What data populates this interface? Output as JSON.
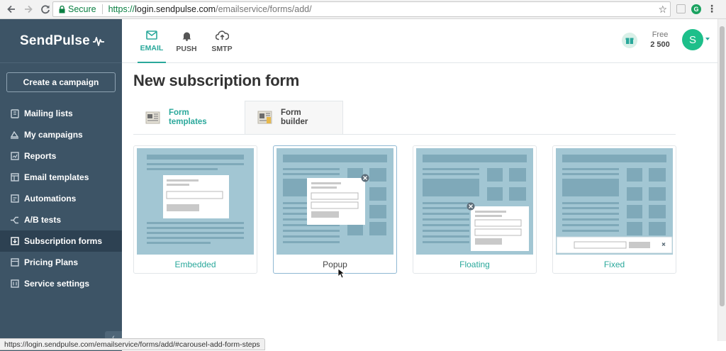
{
  "browser": {
    "secure_label": "Secure",
    "url_scheme": "https://",
    "url_host": "login.sendpulse.com",
    "url_path": "/emailservice/forms/add/",
    "status_url": "https://login.sendpulse.com/emailservice/forms/add/#carousel-add-form-steps"
  },
  "sidebar": {
    "logo": "SendPulse",
    "create_button": "Create a campaign",
    "items": [
      {
        "label": "Mailing lists",
        "icon": "book-icon"
      },
      {
        "label": "My campaigns",
        "icon": "campaign-icon"
      },
      {
        "label": "Reports",
        "icon": "chart-icon"
      },
      {
        "label": "Email templates",
        "icon": "template-icon"
      },
      {
        "label": "Automations",
        "icon": "automation-icon"
      },
      {
        "label": "A/B tests",
        "icon": "split-icon"
      },
      {
        "label": "Subscription forms",
        "icon": "form-icon",
        "active": true
      },
      {
        "label": "Pricing Plans",
        "icon": "pricing-icon"
      },
      {
        "label": "Service settings",
        "icon": "settings-icon"
      }
    ]
  },
  "header": {
    "channels": [
      {
        "label": "EMAIL",
        "icon": "envelope-icon",
        "active": true
      },
      {
        "label": "PUSH",
        "icon": "bell-icon"
      },
      {
        "label": "SMTP",
        "icon": "cloud-upload-icon"
      }
    ],
    "plan_name": "Free",
    "plan_count": "2 500",
    "avatar_initial": "S"
  },
  "main": {
    "title": "New subscription form",
    "tabs": [
      {
        "label_line1": "Form",
        "label_line2": "templates"
      },
      {
        "label_line1": "Form",
        "label_line2": "builder",
        "active": true
      }
    ],
    "cards": [
      {
        "label": "Embedded"
      },
      {
        "label": "Popup",
        "selected": true
      },
      {
        "label": "Floating"
      },
      {
        "label": "Fixed"
      }
    ]
  },
  "colors": {
    "sidebar": "#3d5466",
    "accent": "#2aa89b",
    "card_preview": "#a2c6d3"
  }
}
